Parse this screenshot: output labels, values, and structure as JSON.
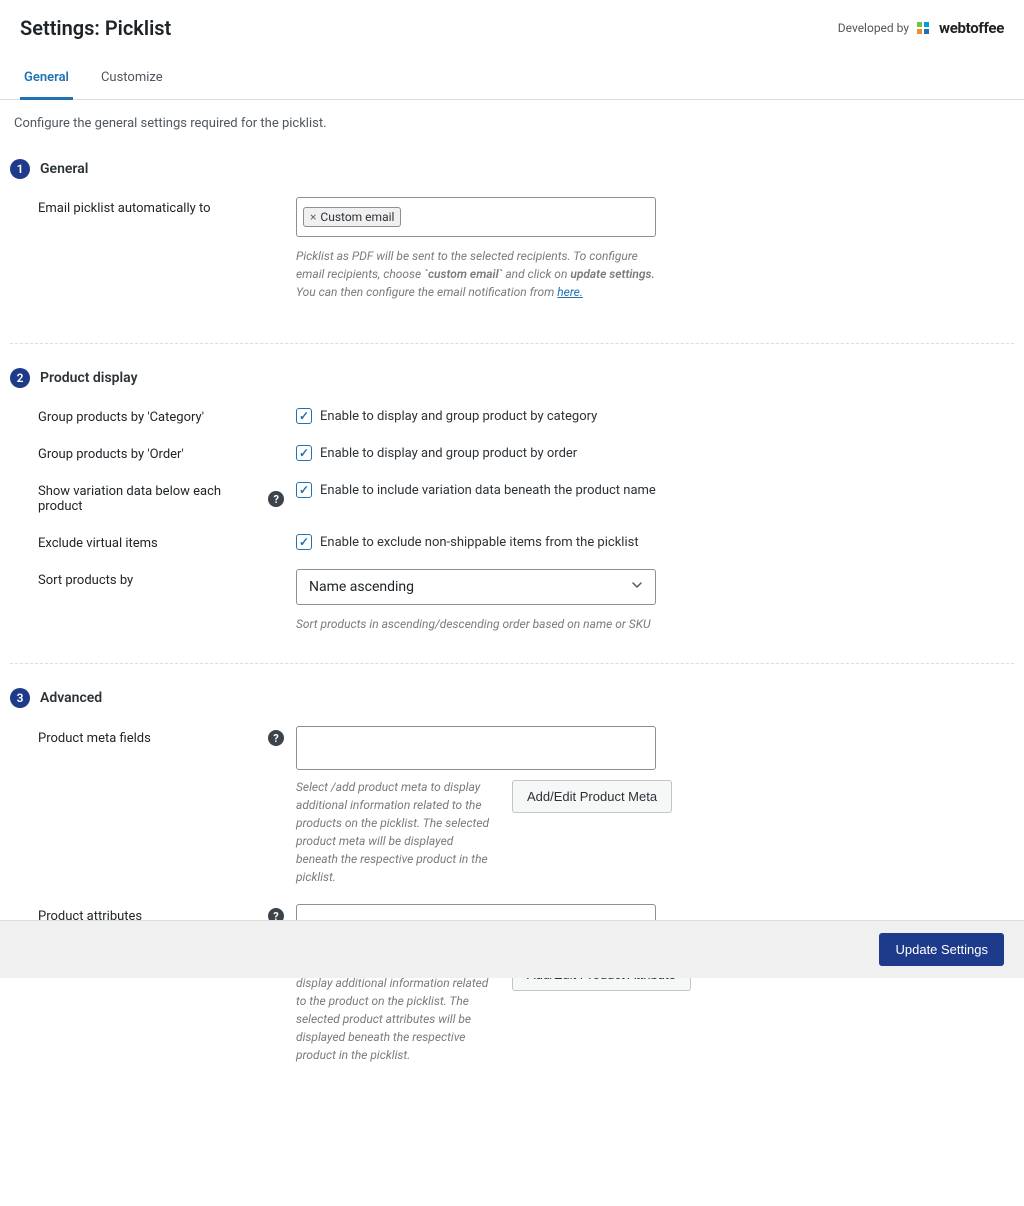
{
  "header": {
    "title": "Settings: Picklist",
    "developed_by": "Developed by",
    "brand": "webtoffee"
  },
  "tabs": [
    {
      "label": "General",
      "active": true
    },
    {
      "label": "Customize",
      "active": false
    }
  ],
  "intro": "Configure the general settings required for the picklist.",
  "sections": {
    "general": {
      "num": "1",
      "title": "General",
      "email_label": "Email picklist automatically to",
      "email_chip": "Custom email",
      "email_help_pre": "Picklist as PDF will be sent to the selected recipients. To configure email recipients, choose ",
      "email_help_bold1": "`custom email`",
      "email_help_mid": " and click on ",
      "email_help_bold2": "update settings.",
      "email_help_post": " You can then configure the email notification from ",
      "email_help_link": "here."
    },
    "product": {
      "num": "2",
      "title": "Product display",
      "group_category_label": "Group products by 'Category'",
      "group_category_cb": "Enable to display and group product by category",
      "group_order_label": "Group products by 'Order'",
      "group_order_cb": "Enable to display and group product by order",
      "variation_label": "Show variation data below each product",
      "variation_cb": "Enable to include variation data beneath the product name",
      "exclude_label": "Exclude virtual items",
      "exclude_cb": "Enable to exclude non-shippable items from the picklist",
      "sort_label": "Sort products by",
      "sort_value": "Name ascending",
      "sort_help": "Sort products in ascending/descending order based on name or SKU"
    },
    "advanced": {
      "num": "3",
      "title": "Advanced",
      "meta_label": "Product meta fields",
      "meta_help": "Select /add product meta to display additional information related to the products on the picklist. The selected product meta will be displayed beneath the respective product in the picklist.",
      "meta_button": "Add/Edit Product Meta",
      "attr_label": "Product attributes",
      "attr_help": "Select/add product attributes to display additional information related to the product on the picklist. The selected product attributes will be displayed beneath the respective product in the picklist.",
      "attr_button": "Add/Edit Product Attribute"
    }
  },
  "footer": {
    "update": "Update Settings"
  }
}
